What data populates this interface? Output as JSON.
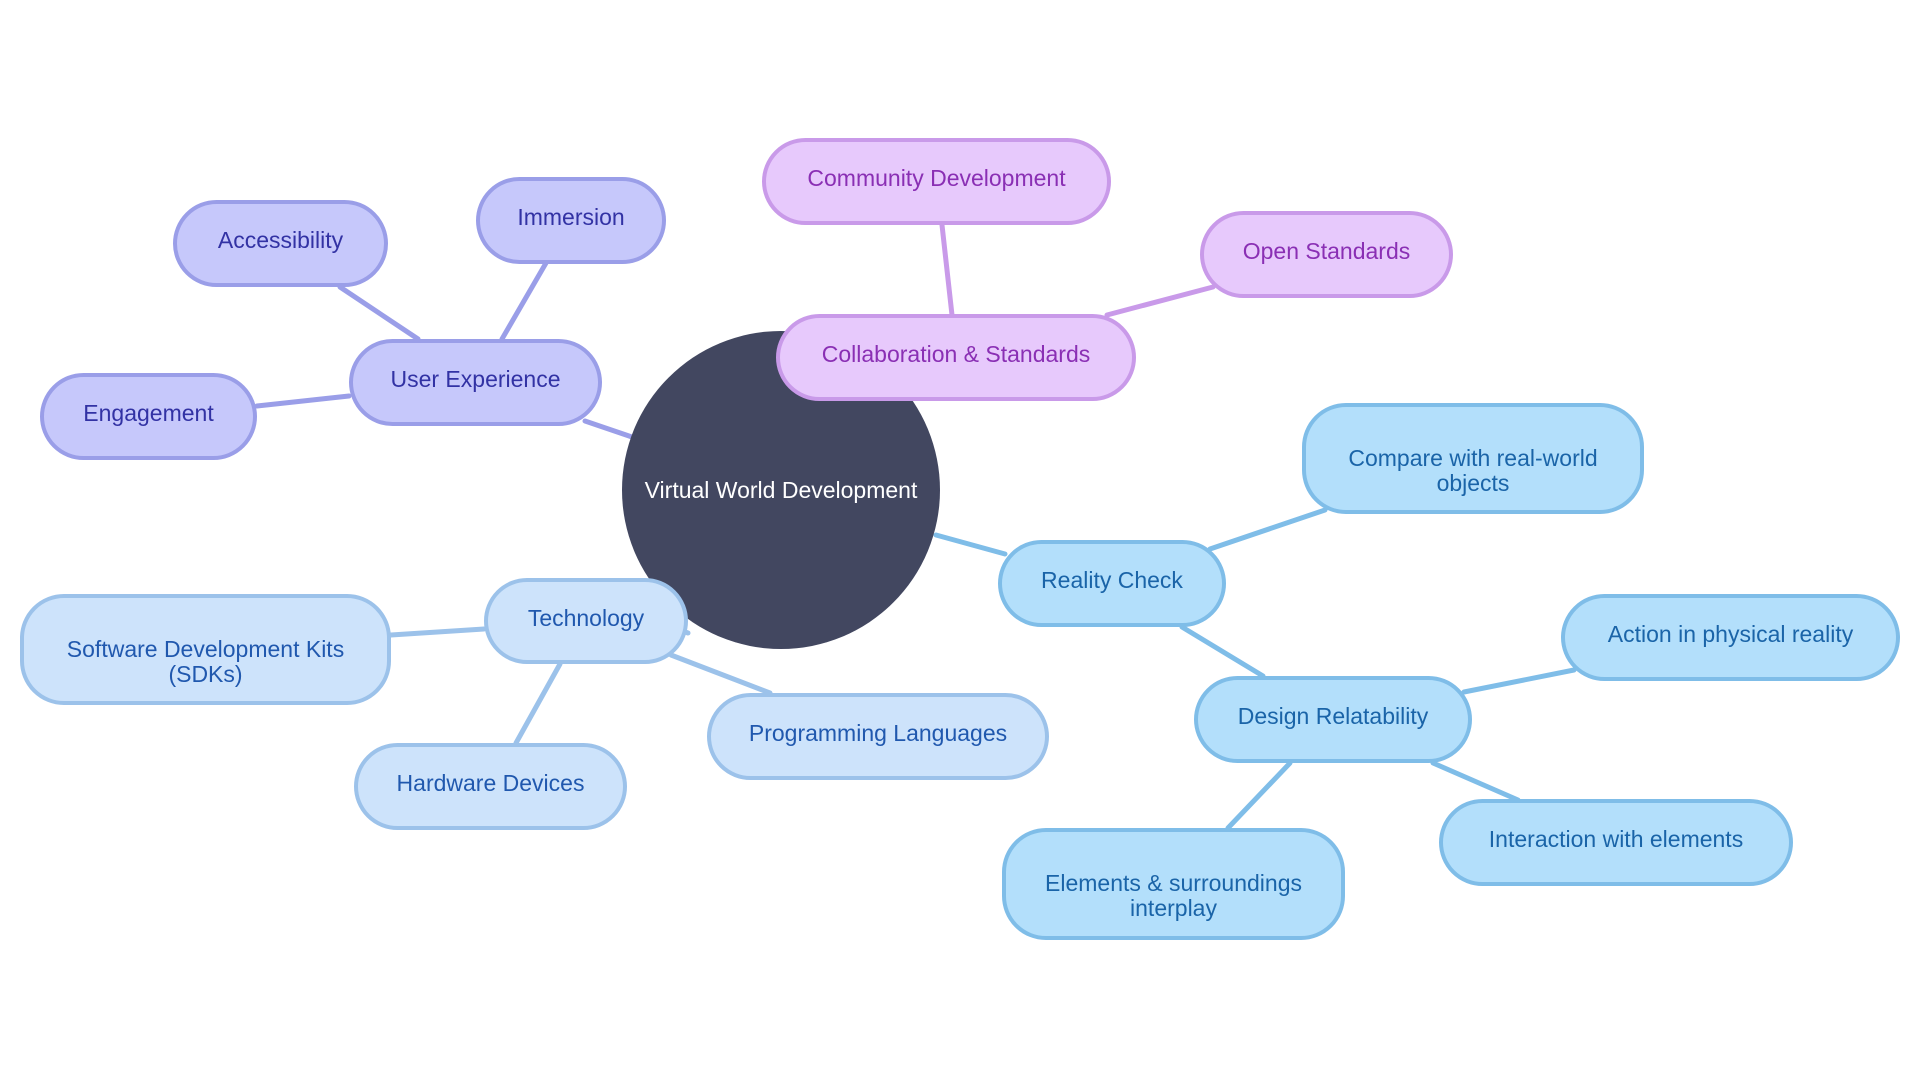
{
  "diagram": {
    "type": "mindmap",
    "root": {
      "label": "Virtual World Development",
      "color": "#424760"
    },
    "branches": [
      {
        "id": "ux",
        "label": "User Experience",
        "colors": {
          "fill": "#c6c8fb",
          "border": "#9a9ee8",
          "text": "#3232a4"
        },
        "children": [
          "Engagement",
          "Accessibility",
          "Immersion"
        ]
      },
      {
        "id": "co",
        "label": "Collaboration & Standards",
        "colors": {
          "fill": "#e7c9fc",
          "border": "#c99ae9",
          "text": "#8a2fb4"
        },
        "children": [
          "Community Development",
          "Open Standards"
        ]
      },
      {
        "id": "re",
        "label": "Reality Check",
        "colors": {
          "fill": "#b3dffb",
          "border": "#7fbde8",
          "text": "#1a64a8"
        },
        "children": [
          "Compare with real-world objects",
          "Design Relatability"
        ],
        "grandchildren": {
          "Design Relatability": [
            "Action in physical reality",
            "Elements & surroundings interplay",
            "Interaction with elements"
          ]
        }
      },
      {
        "id": "te",
        "label": "Technology",
        "colors": {
          "fill": "#cde3fb",
          "border": "#9cc2ea",
          "text": "#2058ae"
        },
        "children": [
          "Software Development Kits (SDKs)",
          "Hardware Devices",
          "Programming Languages"
        ]
      }
    ]
  },
  "nodes": {
    "root": "Virtual World Development",
    "user_experience": "User Experience",
    "engagement": "Engagement",
    "accessibility": "Accessibility",
    "immersion": "Immersion",
    "collaboration": "Collaboration & Standards",
    "community": "Community Development",
    "open_standards": "Open Standards",
    "reality_check": "Reality Check",
    "compare_line1": "Compare with real-world",
    "compare_line2": "objects",
    "design_relatability": "Design Relatability",
    "action": "Action in physical reality",
    "elements_line1": "Elements & surroundings",
    "elements_line2": "interplay",
    "interaction": "Interaction with elements",
    "technology": "Technology",
    "sdk_line1": "Software Development Kits",
    "sdk_line2": "(SDKs)",
    "hardware": "Hardware Devices",
    "programming": "Programming Languages"
  }
}
